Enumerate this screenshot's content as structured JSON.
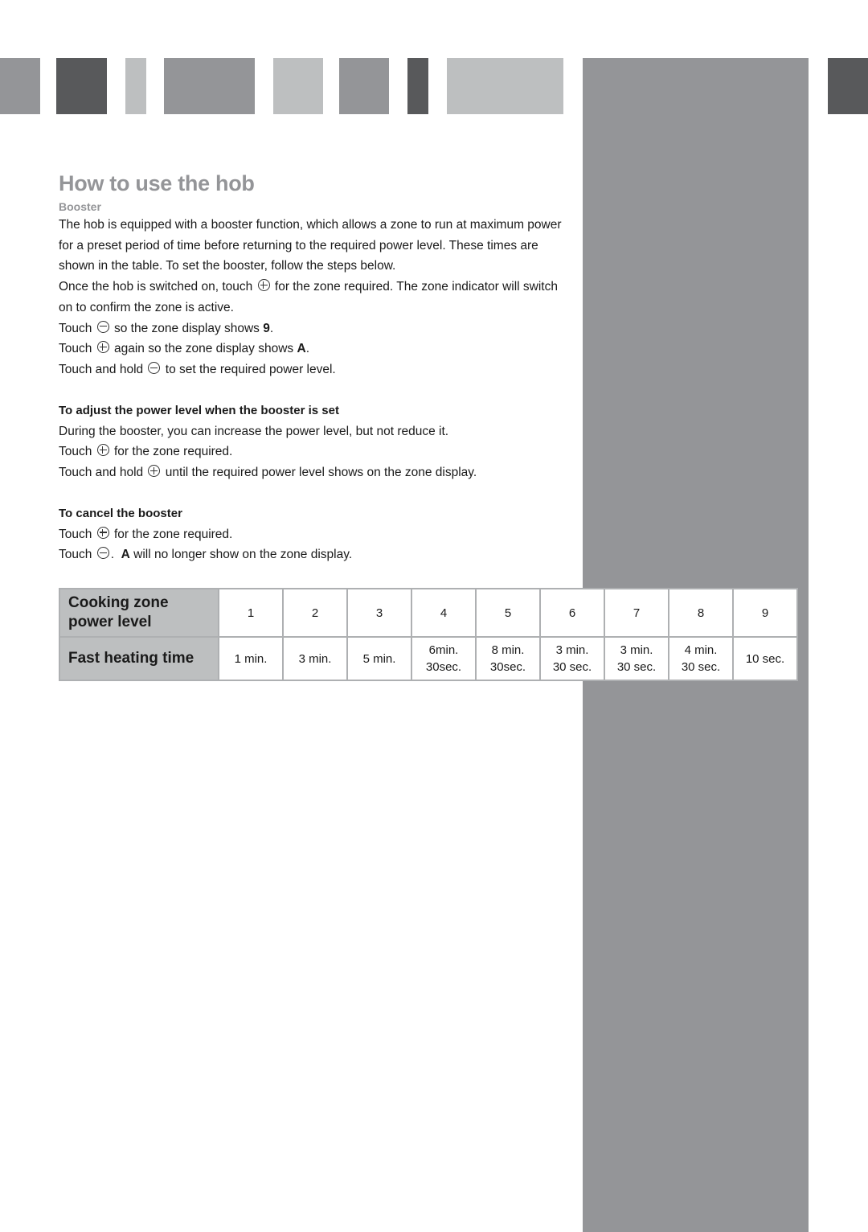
{
  "header": {
    "title": "How to use the hob",
    "subtitle": "Booster"
  },
  "intro": [
    "The hob is equipped with a booster function, which allows a zone to run at maximum power for a preset period of time before returning to the required power level.  These times are shown in the table.  To set the booster, follow the steps below."
  ],
  "steps": {
    "s1_a": "Once the hob is switched on, touch",
    "s1_b": "for the zone required. The zone indicator will switch on to confirm the zone is active.",
    "s2_a": "Touch",
    "s2_b": "so the zone display shows",
    "s2_bold": "9",
    "s2_end": ".",
    "s3_a": "Touch",
    "s3_b": "again so the zone display shows",
    "s3_bold": "A",
    "s3_end": ".",
    "s4_a": "Touch and hold",
    "s4_b": "to set the required power level."
  },
  "adjust": {
    "heading": "To adjust the power level when the booster is set",
    "line1": "During the booster, you can increase the power level, but not reduce it.",
    "line2_a": "Touch",
    "line2_b": "for the zone required.",
    "line3_a": "Touch and hold",
    "line3_b": "until the required power level shows on the zone display."
  },
  "cancel": {
    "heading": "To cancel the booster",
    "line1_a": "Touch",
    "line1_b": "for the zone required.",
    "line2_a": "Touch",
    "line2_b": ".",
    "line2_bold": "A",
    "line2_c": "will no longer show on the zone display."
  },
  "icons": {
    "plus": "plus-circle-icon",
    "minus": "minus-circle-icon"
  },
  "table": {
    "row1_header_l1": "Cooking zone",
    "row1_header_l2": "power level",
    "row2_header": "Fast heating time",
    "levels": [
      "1",
      "2",
      "3",
      "4",
      "5",
      "6",
      "7",
      "8",
      "9"
    ],
    "times": [
      [
        "1 min.",
        ""
      ],
      [
        "3 min.",
        ""
      ],
      [
        "5 min.",
        ""
      ],
      [
        "6min.",
        "30sec."
      ],
      [
        "8 min.",
        "30sec."
      ],
      [
        "3 min.",
        "30 sec."
      ],
      [
        "3 min.",
        "30 sec."
      ],
      [
        "4 min.",
        "30 sec."
      ],
      [
        "10 sec.",
        ""
      ]
    ]
  },
  "colors": {
    "light_grey": "#bdbfc0",
    "mid_grey": "#949598",
    "dark_grey": "#58595b"
  }
}
